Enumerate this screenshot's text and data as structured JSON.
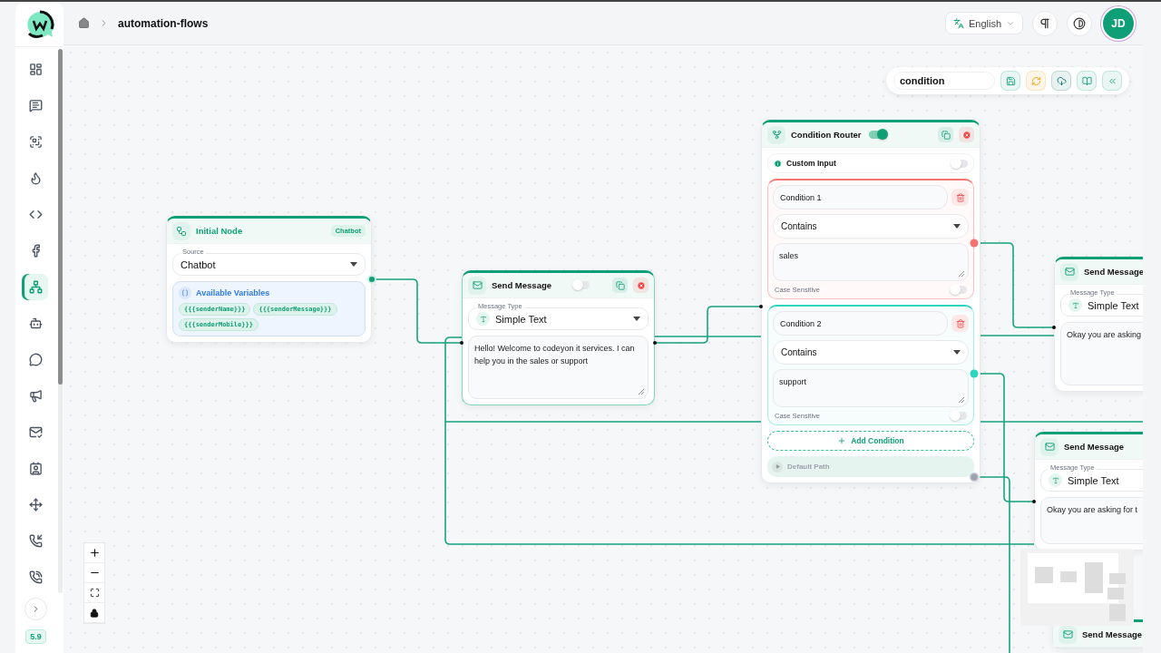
{
  "sidebar": {
    "items": [
      {
        "selected": false
      },
      {
        "selected": false
      },
      {
        "selected": false
      },
      {
        "selected": false
      },
      {
        "selected": false
      },
      {
        "selected": false
      },
      {
        "selected": true
      },
      {
        "selected": false
      },
      {
        "selected": false
      },
      {
        "selected": false
      },
      {
        "selected": false
      },
      {
        "selected": false
      },
      {
        "selected": false
      },
      {
        "selected": false
      },
      {
        "selected": false
      }
    ],
    "version": "5.9"
  },
  "breadcrumb": {
    "current": "automation-flows"
  },
  "header": {
    "language": "English",
    "avatar": "JD"
  },
  "toolbar": {
    "flow_name": "condition"
  },
  "nodes": [
    {
      "kind": "initial",
      "title": "Initial Node",
      "badge": "Chatbot",
      "source_label": "Source",
      "source": "Chatbot",
      "variables_title": "Available Variables",
      "variables": [
        "{{{senderName}}}",
        "{{{senderMessage}}}",
        "{{{senderMobile}}}"
      ]
    },
    {
      "kind": "send_message",
      "title": "Send Message",
      "enabled": false,
      "type_label": "Message Type",
      "type": "Simple Text",
      "message": "Hello! Welcome to codeyon it services. I can help you in the sales or support"
    },
    {
      "kind": "condition_router",
      "title": "Condition Router",
      "enabled": true,
      "custom_input": {
        "label": "Custom Input",
        "on": false
      },
      "conditions": [
        {
          "name": "Condition 1",
          "operator": "Contains",
          "value": "sales",
          "case_label": "Case Sensitive",
          "case_sensitive": false,
          "color": "#f87171"
        },
        {
          "name": "Condition 2",
          "operator": "Contains",
          "value": "support",
          "case_label": "Case Sensitive",
          "case_sensitive": false,
          "color": "#2dd4bf"
        }
      ],
      "add_label": "Add Condition",
      "default_label": "Default Path"
    },
    {
      "kind": "send_message",
      "title": "Send Message",
      "type_label": "Message Type",
      "type": "Simple Text",
      "message": "Okay you are asking"
    },
    {
      "kind": "send_message",
      "title": "Send Message",
      "type_label": "Message Type",
      "type": "Simple Text",
      "message": "Okay you are asking for t"
    },
    {
      "kind": "send_message",
      "title": "Send Message"
    }
  ]
}
